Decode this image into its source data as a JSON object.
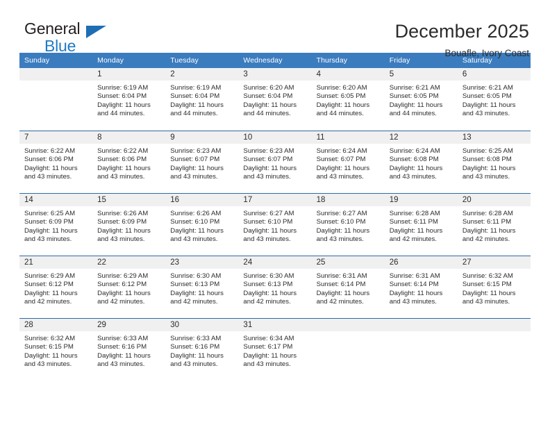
{
  "logo": {
    "word_one": "General",
    "word_two": "Blue",
    "triangle_color": "#1e6eb4",
    "text_color": "#231f20",
    "blue_color": "#1f7ac4"
  },
  "header": {
    "title": "December 2025",
    "subtitle": "Bouafle, Ivory Coast"
  },
  "colors": {
    "header_row_bg": "#3b7cbf",
    "header_row_text": "#ffffff",
    "daynum_band_bg": "#f0f0f0",
    "row_separator": "#2c6ba8",
    "body_text": "#2b2b2b"
  },
  "calendar": {
    "weekday_headers": [
      "Sunday",
      "Monday",
      "Tuesday",
      "Wednesday",
      "Thursday",
      "Friday",
      "Saturday"
    ],
    "labels": {
      "sunrise_prefix": "Sunrise:",
      "sunset_prefix": "Sunset:",
      "daylight_prefix": "Daylight:"
    },
    "weeks": [
      [
        {
          "day": "",
          "sunrise": "",
          "sunset": "",
          "daylight": ""
        },
        {
          "day": "1",
          "sunrise": "Sunrise: 6:19 AM",
          "sunset": "Sunset: 6:04 PM",
          "daylight": "Daylight: 11 hours and 44 minutes."
        },
        {
          "day": "2",
          "sunrise": "Sunrise: 6:19 AM",
          "sunset": "Sunset: 6:04 PM",
          "daylight": "Daylight: 11 hours and 44 minutes."
        },
        {
          "day": "3",
          "sunrise": "Sunrise: 6:20 AM",
          "sunset": "Sunset: 6:04 PM",
          "daylight": "Daylight: 11 hours and 44 minutes."
        },
        {
          "day": "4",
          "sunrise": "Sunrise: 6:20 AM",
          "sunset": "Sunset: 6:05 PM",
          "daylight": "Daylight: 11 hours and 44 minutes."
        },
        {
          "day": "5",
          "sunrise": "Sunrise: 6:21 AM",
          "sunset": "Sunset: 6:05 PM",
          "daylight": "Daylight: 11 hours and 44 minutes."
        },
        {
          "day": "6",
          "sunrise": "Sunrise: 6:21 AM",
          "sunset": "Sunset: 6:05 PM",
          "daylight": "Daylight: 11 hours and 43 minutes."
        }
      ],
      [
        {
          "day": "7",
          "sunrise": "Sunrise: 6:22 AM",
          "sunset": "Sunset: 6:06 PM",
          "daylight": "Daylight: 11 hours and 43 minutes."
        },
        {
          "day": "8",
          "sunrise": "Sunrise: 6:22 AM",
          "sunset": "Sunset: 6:06 PM",
          "daylight": "Daylight: 11 hours and 43 minutes."
        },
        {
          "day": "9",
          "sunrise": "Sunrise: 6:23 AM",
          "sunset": "Sunset: 6:07 PM",
          "daylight": "Daylight: 11 hours and 43 minutes."
        },
        {
          "day": "10",
          "sunrise": "Sunrise: 6:23 AM",
          "sunset": "Sunset: 6:07 PM",
          "daylight": "Daylight: 11 hours and 43 minutes."
        },
        {
          "day": "11",
          "sunrise": "Sunrise: 6:24 AM",
          "sunset": "Sunset: 6:07 PM",
          "daylight": "Daylight: 11 hours and 43 minutes."
        },
        {
          "day": "12",
          "sunrise": "Sunrise: 6:24 AM",
          "sunset": "Sunset: 6:08 PM",
          "daylight": "Daylight: 11 hours and 43 minutes."
        },
        {
          "day": "13",
          "sunrise": "Sunrise: 6:25 AM",
          "sunset": "Sunset: 6:08 PM",
          "daylight": "Daylight: 11 hours and 43 minutes."
        }
      ],
      [
        {
          "day": "14",
          "sunrise": "Sunrise: 6:25 AM",
          "sunset": "Sunset: 6:09 PM",
          "daylight": "Daylight: 11 hours and 43 minutes."
        },
        {
          "day": "15",
          "sunrise": "Sunrise: 6:26 AM",
          "sunset": "Sunset: 6:09 PM",
          "daylight": "Daylight: 11 hours and 43 minutes."
        },
        {
          "day": "16",
          "sunrise": "Sunrise: 6:26 AM",
          "sunset": "Sunset: 6:10 PM",
          "daylight": "Daylight: 11 hours and 43 minutes."
        },
        {
          "day": "17",
          "sunrise": "Sunrise: 6:27 AM",
          "sunset": "Sunset: 6:10 PM",
          "daylight": "Daylight: 11 hours and 43 minutes."
        },
        {
          "day": "18",
          "sunrise": "Sunrise: 6:27 AM",
          "sunset": "Sunset: 6:10 PM",
          "daylight": "Daylight: 11 hours and 43 minutes."
        },
        {
          "day": "19",
          "sunrise": "Sunrise: 6:28 AM",
          "sunset": "Sunset: 6:11 PM",
          "daylight": "Daylight: 11 hours and 42 minutes."
        },
        {
          "day": "20",
          "sunrise": "Sunrise: 6:28 AM",
          "sunset": "Sunset: 6:11 PM",
          "daylight": "Daylight: 11 hours and 42 minutes."
        }
      ],
      [
        {
          "day": "21",
          "sunrise": "Sunrise: 6:29 AM",
          "sunset": "Sunset: 6:12 PM",
          "daylight": "Daylight: 11 hours and 42 minutes."
        },
        {
          "day": "22",
          "sunrise": "Sunrise: 6:29 AM",
          "sunset": "Sunset: 6:12 PM",
          "daylight": "Daylight: 11 hours and 42 minutes."
        },
        {
          "day": "23",
          "sunrise": "Sunrise: 6:30 AM",
          "sunset": "Sunset: 6:13 PM",
          "daylight": "Daylight: 11 hours and 42 minutes."
        },
        {
          "day": "24",
          "sunrise": "Sunrise: 6:30 AM",
          "sunset": "Sunset: 6:13 PM",
          "daylight": "Daylight: 11 hours and 42 minutes."
        },
        {
          "day": "25",
          "sunrise": "Sunrise: 6:31 AM",
          "sunset": "Sunset: 6:14 PM",
          "daylight": "Daylight: 11 hours and 42 minutes."
        },
        {
          "day": "26",
          "sunrise": "Sunrise: 6:31 AM",
          "sunset": "Sunset: 6:14 PM",
          "daylight": "Daylight: 11 hours and 43 minutes."
        },
        {
          "day": "27",
          "sunrise": "Sunrise: 6:32 AM",
          "sunset": "Sunset: 6:15 PM",
          "daylight": "Daylight: 11 hours and 43 minutes."
        }
      ],
      [
        {
          "day": "28",
          "sunrise": "Sunrise: 6:32 AM",
          "sunset": "Sunset: 6:15 PM",
          "daylight": "Daylight: 11 hours and 43 minutes."
        },
        {
          "day": "29",
          "sunrise": "Sunrise: 6:33 AM",
          "sunset": "Sunset: 6:16 PM",
          "daylight": "Daylight: 11 hours and 43 minutes."
        },
        {
          "day": "30",
          "sunrise": "Sunrise: 6:33 AM",
          "sunset": "Sunset: 6:16 PM",
          "daylight": "Daylight: 11 hours and 43 minutes."
        },
        {
          "day": "31",
          "sunrise": "Sunrise: 6:34 AM",
          "sunset": "Sunset: 6:17 PM",
          "daylight": "Daylight: 11 hours and 43 minutes."
        },
        {
          "day": "",
          "sunrise": "",
          "sunset": "",
          "daylight": ""
        },
        {
          "day": "",
          "sunrise": "",
          "sunset": "",
          "daylight": ""
        },
        {
          "day": "",
          "sunrise": "",
          "sunset": "",
          "daylight": ""
        }
      ]
    ]
  }
}
